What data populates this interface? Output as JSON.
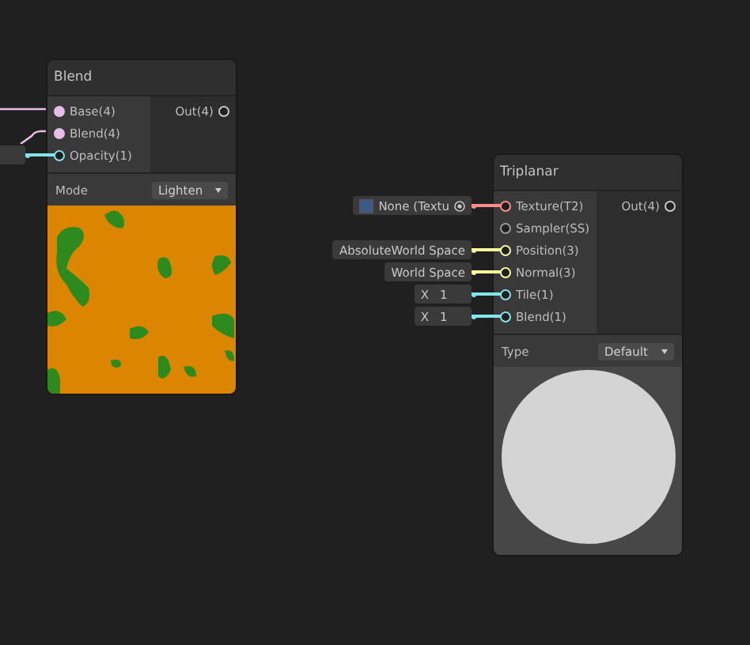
{
  "nodes": [
    {
      "title": "Blend",
      "kind": "blend",
      "inputs": [
        {
          "label": "Base(4)",
          "connected": true,
          "color": "#e8bde8"
        },
        {
          "label": "Blend(4)",
          "connected": true,
          "color": "#e8bde8"
        },
        {
          "label": "Opacity(1)",
          "connected": false,
          "color": "#84e4e7",
          "field": {
            "kind": "blank"
          }
        }
      ],
      "outputs": [
        {
          "label": "Out(4)",
          "connected": false,
          "color": "#c8c8c8"
        }
      ],
      "property": {
        "label": "Mode",
        "value": "Lighten"
      },
      "preview": {
        "kind": "picture"
      }
    },
    {
      "title": "Triplanar",
      "kind": "triplanar",
      "inputs": [
        {
          "label": "Texture(T2)",
          "connected": false,
          "color": "#ff8b8b",
          "field": {
            "kind": "texture",
            "text": "None (Textu"
          }
        },
        {
          "label": "Sampler(SS)",
          "connected": false,
          "color": "#9a9a9a"
        },
        {
          "label": "Position(3)",
          "connected": false,
          "color": "#f6ff9a",
          "field": {
            "kind": "text",
            "text": "AbsoluteWorld Space"
          }
        },
        {
          "label": "Normal(3)",
          "connected": false,
          "color": "#f6ff9a",
          "field": {
            "kind": "text",
            "text": "World Space"
          }
        },
        {
          "label": "Tile(1)",
          "connected": false,
          "color": "#84e4e7",
          "field": {
            "kind": "number",
            "axis": "X",
            "text": "1"
          }
        },
        {
          "label": "Blend(1)",
          "connected": false,
          "color": "#84e4e7",
          "field": {
            "kind": "number",
            "axis": "X",
            "text": "1"
          }
        }
      ],
      "outputs": [
        {
          "label": "Out(4)",
          "connected": false,
          "color": "#c8c8c8"
        }
      ],
      "property": {
        "label": "Type",
        "value": "Default"
      },
      "preview": {
        "kind": "picture"
      }
    }
  ]
}
